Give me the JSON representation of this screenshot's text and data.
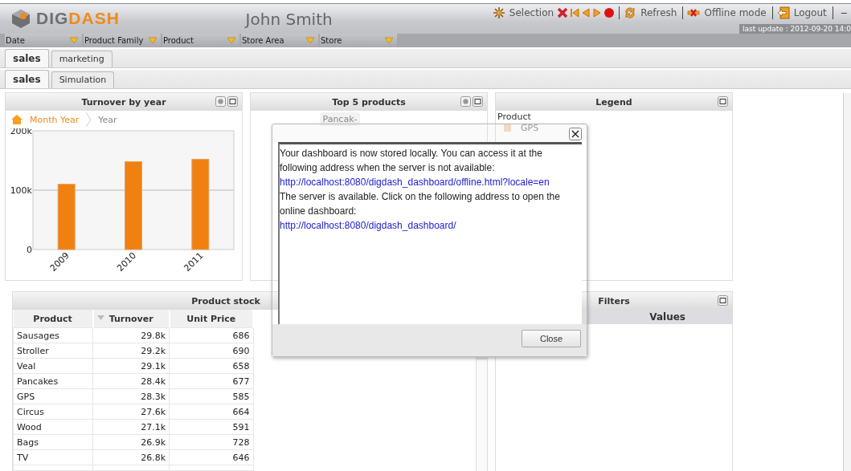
{
  "header": {
    "logo_text": [
      "DIG",
      "DASH"
    ],
    "user": "John Smith",
    "toolbar": {
      "selection": "Selection",
      "refresh": "Refresh",
      "offline": "Offline mode",
      "logout": "Logout",
      "minimize": "−"
    },
    "last_update": "last update : 2012-09-20 14:0"
  },
  "filters": [
    "Date",
    "Product Family",
    "Product",
    "Store Area",
    "Store"
  ],
  "tab_rows": [
    [
      {
        "label": "sales",
        "selected": true
      },
      {
        "label": "marketing",
        "selected": false
      }
    ],
    [
      {
        "label": "sales",
        "selected": true
      },
      {
        "label": "Simulation",
        "selected": false
      }
    ]
  ],
  "turnover_panel": {
    "title": "Turnover by year",
    "breadcrumb": [
      "Month Year",
      "Year"
    ],
    "chart_data": {
      "type": "bar",
      "categories": [
        "2009",
        "2010",
        "2011"
      ],
      "series": [
        {
          "color": "#f08010",
          "values": [
            110000,
            148000,
            152000
          ]
        }
      ],
      "ylim": [
        0,
        200000
      ],
      "yticks": [
        {
          "value": 0,
          "label": "0"
        },
        {
          "value": 100000,
          "label": "100k"
        },
        {
          "value": 200000,
          "label": "200k"
        }
      ]
    }
  },
  "top5_panel": {
    "title": "Top 5 products",
    "item": "Pancak-"
  },
  "legend_panel": {
    "title": "Legend",
    "heading": "Product",
    "items": [
      "GPS"
    ]
  },
  "stock_panel": {
    "title": "Product stock",
    "columns": [
      {
        "label": "Product",
        "sorted": false
      },
      {
        "label": "Turnover",
        "sorted": true
      },
      {
        "label": "Unit Price",
        "sorted": false
      }
    ],
    "rows": [
      [
        "Sausages",
        "29.8k",
        "686"
      ],
      [
        "Stroller",
        "29.2k",
        "690"
      ],
      [
        "Veal",
        "29.1k",
        "658"
      ],
      [
        "Pancakes",
        "28.4k",
        "677"
      ],
      [
        "GPS",
        "28.3k",
        "585"
      ],
      [
        "Circus",
        "27.6k",
        "664"
      ],
      [
        "Wood",
        "27.1k",
        "591"
      ],
      [
        "Bags",
        "26.9k",
        "728"
      ],
      [
        "TV",
        "26.8k",
        "646"
      ]
    ]
  },
  "filters_panel": {
    "title": "Filters",
    "column_header": "Values"
  },
  "dialog": {
    "lines": [
      {
        "kind": "text",
        "text": "Your dashboard is now stored locally. You can access it at the following address when the server is not available:"
      },
      {
        "kind": "link",
        "text": "http://localhost:8080/digdash_dashboard/offline.html?locale=en"
      },
      {
        "kind": "text",
        "text": "The server is available. Click on the following address to open the online dashboard:"
      },
      {
        "kind": "link",
        "text": "http://localhost:8080/digdash_dashboard/"
      }
    ],
    "button": "Close"
  }
}
